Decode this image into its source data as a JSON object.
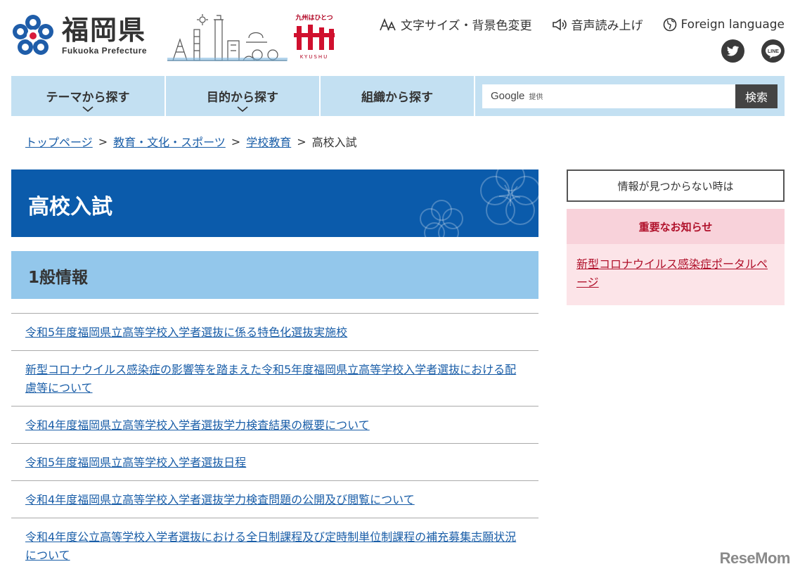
{
  "header": {
    "logo_jp": "福岡県",
    "logo_en": "Fukuoka Prefecture",
    "kyushu_top": "九州はひとつ",
    "kyushu_bottom": "KYUSHU",
    "utility": {
      "text_size": "文字サイズ・背景色変更",
      "read_aloud": "音声読み上げ",
      "foreign": "Foreign language"
    },
    "social": {
      "line": "LINE"
    }
  },
  "nav": {
    "items": [
      {
        "label": "テーマから探す"
      },
      {
        "label": "目的から探す"
      },
      {
        "label": "組織から探す"
      }
    ],
    "search": {
      "google": "Google",
      "provided": "提供",
      "button": "検索"
    }
  },
  "breadcrumb": {
    "top": "トップページ",
    "sep": ">",
    "level1": "教育・文化・スポーツ",
    "level2": "学校教育",
    "current": "高校入試"
  },
  "main": {
    "title": "高校入試",
    "section_title": "1般情報",
    "links": [
      "令和5年度福岡県立高等学校入学者選抜に係る特色化選抜実施校",
      "新型コロナウイルス感染症の影響等を踏まえた令和5年度福岡県立高等学校入学者選抜における配慮等について",
      "令和4年度福岡県立高等学校入学者選抜学力検査結果の概要について",
      "令和5年度福岡県立高等学校入学者選抜日程",
      "令和4年度福岡県立高等学校入学者選抜学力検査問題の公開及び閲覧について",
      "令和4年度公立高等学校入学者選抜における全日制課程及び定時制単位制課程の補充募集志願状況について"
    ]
  },
  "sidebar": {
    "not_found": "情報が見つからない時は",
    "notice_title": "重要なお知らせ",
    "notice_link": "新型コロナウイルス感染症ポータルページ"
  },
  "watermark": "ReseMom",
  "colors": {
    "nav_bg": "#c3e0f2",
    "title_bg": "#0b5bab",
    "section_bg": "#93c7eb",
    "link": "#1a5ea8",
    "notice_bg": "#fce4e8",
    "notice_accent": "#b0102a"
  }
}
